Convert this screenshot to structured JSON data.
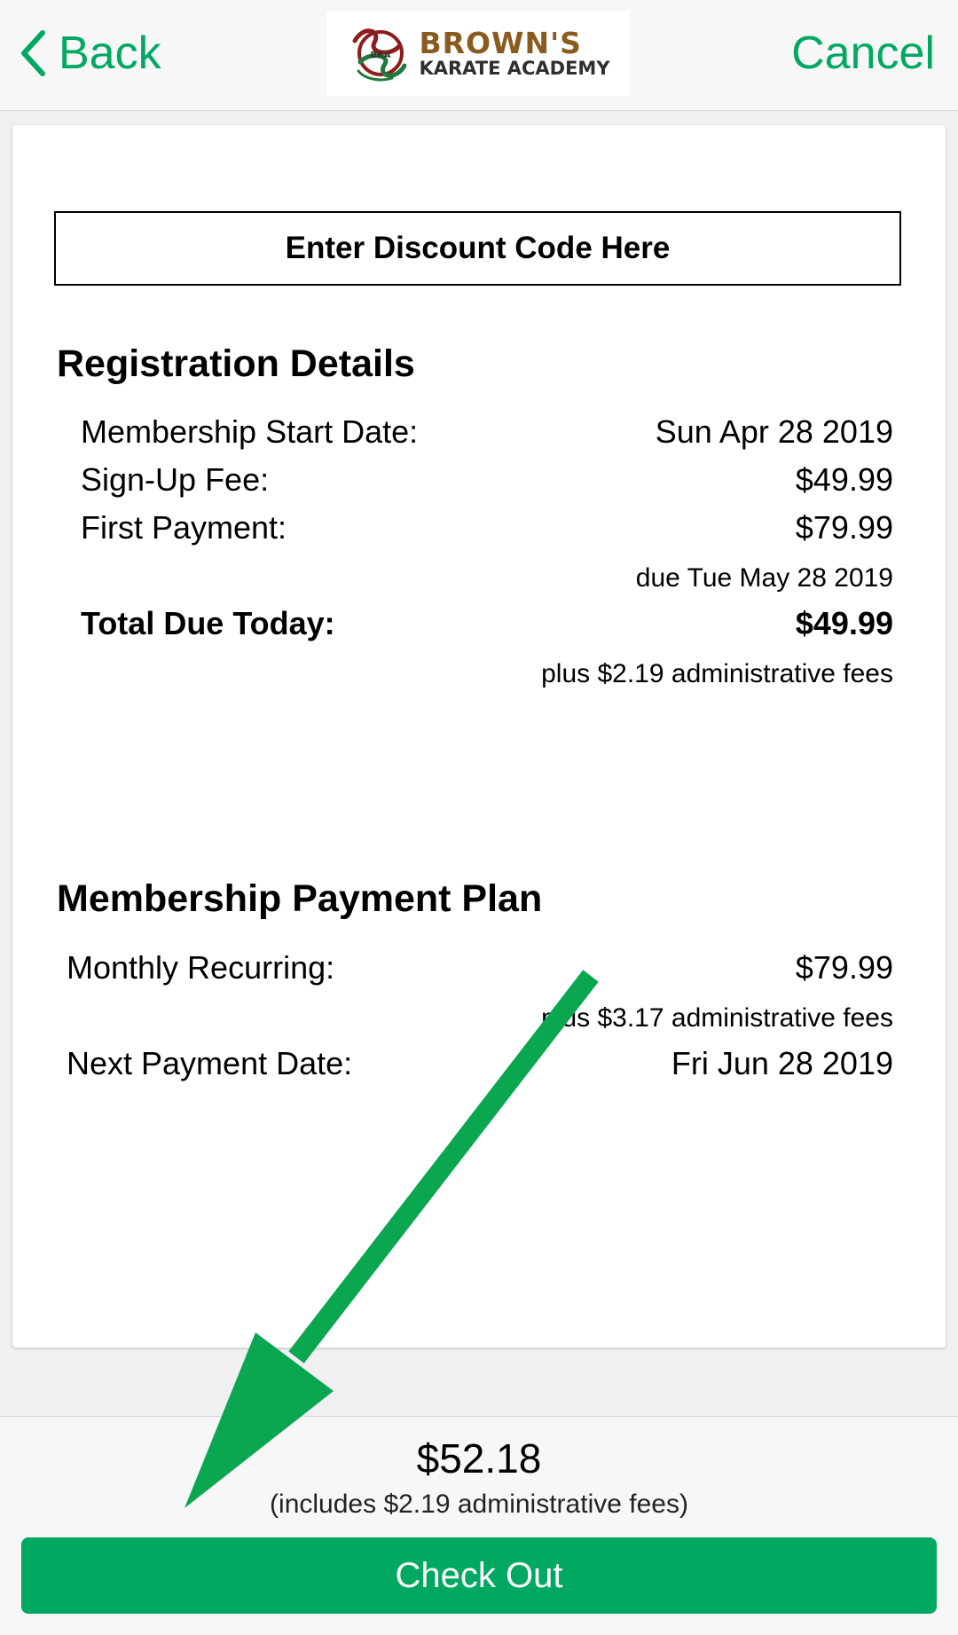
{
  "header": {
    "back_label": "Back",
    "cancel_label": "Cancel",
    "logo_line1": "BROWN'S",
    "logo_line2": "KARATE ACADEMY",
    "logo_monogram": "BKA"
  },
  "discount": {
    "label": "Enter Discount Code Here"
  },
  "registration": {
    "title": "Registration Details",
    "start_date_label": "Membership Start Date:",
    "start_date_value": "Sun Apr 28 2019",
    "signup_fee_label": "Sign-Up Fee:",
    "signup_fee_value": "$49.99",
    "first_payment_label": "First Payment:",
    "first_payment_value": "$79.99",
    "first_payment_due": "due Tue May 28 2019",
    "total_due_label": "Total Due Today:",
    "total_due_value": "$49.99",
    "admin_fees_note": "plus $2.19 administrative fees"
  },
  "plan": {
    "title": "Membership Payment Plan",
    "monthly_label": "Monthly Recurring:",
    "monthly_value": "$79.99",
    "monthly_fees_note": "plus $3.17 administrative fees",
    "next_date_label": "Next Payment Date:",
    "next_date_value": "Fri Jun 28 2019"
  },
  "footer": {
    "total": "$52.18",
    "total_note": "(includes $2.19 administrative fees)",
    "checkout_label": "Check Out"
  },
  "colors": {
    "accent": "#00a862",
    "annotation_arrow": "#0aa650"
  },
  "icons": {
    "back": "chevron-left-icon",
    "annotation": "arrow-annotation-icon"
  }
}
